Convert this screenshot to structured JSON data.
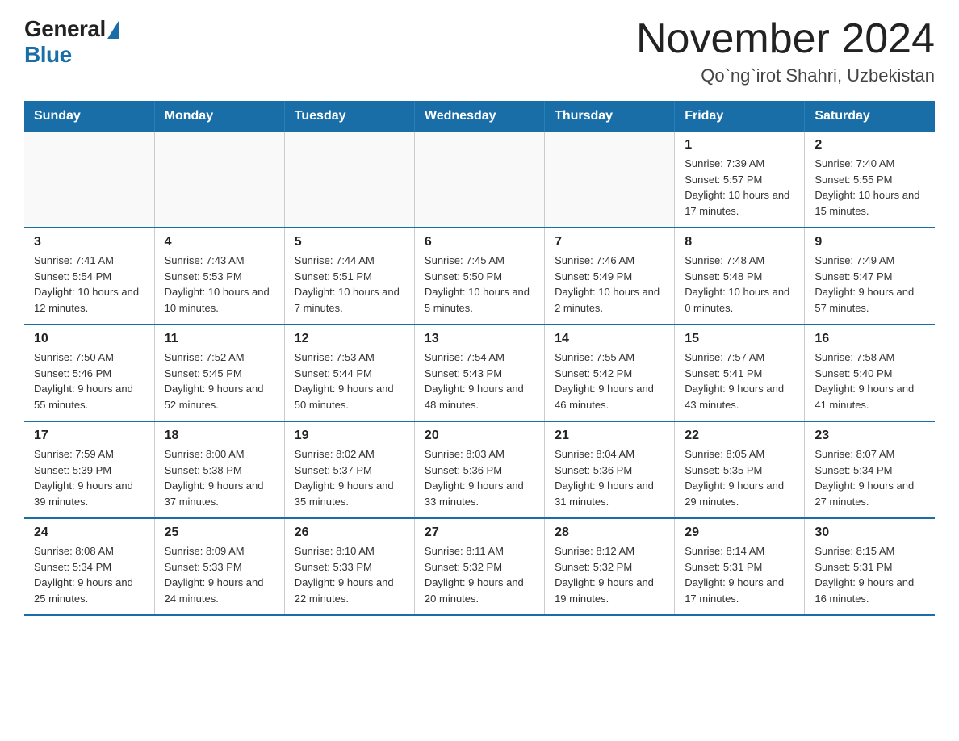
{
  "logo": {
    "general": "General",
    "blue": "Blue"
  },
  "title": "November 2024",
  "location": "Qo`ng`irot Shahri, Uzbekistan",
  "days_of_week": [
    "Sunday",
    "Monday",
    "Tuesday",
    "Wednesday",
    "Thursday",
    "Friday",
    "Saturday"
  ],
  "weeks": [
    [
      {
        "day": "",
        "info": ""
      },
      {
        "day": "",
        "info": ""
      },
      {
        "day": "",
        "info": ""
      },
      {
        "day": "",
        "info": ""
      },
      {
        "day": "",
        "info": ""
      },
      {
        "day": "1",
        "info": "Sunrise: 7:39 AM\nSunset: 5:57 PM\nDaylight: 10 hours and 17 minutes."
      },
      {
        "day": "2",
        "info": "Sunrise: 7:40 AM\nSunset: 5:55 PM\nDaylight: 10 hours and 15 minutes."
      }
    ],
    [
      {
        "day": "3",
        "info": "Sunrise: 7:41 AM\nSunset: 5:54 PM\nDaylight: 10 hours and 12 minutes."
      },
      {
        "day": "4",
        "info": "Sunrise: 7:43 AM\nSunset: 5:53 PM\nDaylight: 10 hours and 10 minutes."
      },
      {
        "day": "5",
        "info": "Sunrise: 7:44 AM\nSunset: 5:51 PM\nDaylight: 10 hours and 7 minutes."
      },
      {
        "day": "6",
        "info": "Sunrise: 7:45 AM\nSunset: 5:50 PM\nDaylight: 10 hours and 5 minutes."
      },
      {
        "day": "7",
        "info": "Sunrise: 7:46 AM\nSunset: 5:49 PM\nDaylight: 10 hours and 2 minutes."
      },
      {
        "day": "8",
        "info": "Sunrise: 7:48 AM\nSunset: 5:48 PM\nDaylight: 10 hours and 0 minutes."
      },
      {
        "day": "9",
        "info": "Sunrise: 7:49 AM\nSunset: 5:47 PM\nDaylight: 9 hours and 57 minutes."
      }
    ],
    [
      {
        "day": "10",
        "info": "Sunrise: 7:50 AM\nSunset: 5:46 PM\nDaylight: 9 hours and 55 minutes."
      },
      {
        "day": "11",
        "info": "Sunrise: 7:52 AM\nSunset: 5:45 PM\nDaylight: 9 hours and 52 minutes."
      },
      {
        "day": "12",
        "info": "Sunrise: 7:53 AM\nSunset: 5:44 PM\nDaylight: 9 hours and 50 minutes."
      },
      {
        "day": "13",
        "info": "Sunrise: 7:54 AM\nSunset: 5:43 PM\nDaylight: 9 hours and 48 minutes."
      },
      {
        "day": "14",
        "info": "Sunrise: 7:55 AM\nSunset: 5:42 PM\nDaylight: 9 hours and 46 minutes."
      },
      {
        "day": "15",
        "info": "Sunrise: 7:57 AM\nSunset: 5:41 PM\nDaylight: 9 hours and 43 minutes."
      },
      {
        "day": "16",
        "info": "Sunrise: 7:58 AM\nSunset: 5:40 PM\nDaylight: 9 hours and 41 minutes."
      }
    ],
    [
      {
        "day": "17",
        "info": "Sunrise: 7:59 AM\nSunset: 5:39 PM\nDaylight: 9 hours and 39 minutes."
      },
      {
        "day": "18",
        "info": "Sunrise: 8:00 AM\nSunset: 5:38 PM\nDaylight: 9 hours and 37 minutes."
      },
      {
        "day": "19",
        "info": "Sunrise: 8:02 AM\nSunset: 5:37 PM\nDaylight: 9 hours and 35 minutes."
      },
      {
        "day": "20",
        "info": "Sunrise: 8:03 AM\nSunset: 5:36 PM\nDaylight: 9 hours and 33 minutes."
      },
      {
        "day": "21",
        "info": "Sunrise: 8:04 AM\nSunset: 5:36 PM\nDaylight: 9 hours and 31 minutes."
      },
      {
        "day": "22",
        "info": "Sunrise: 8:05 AM\nSunset: 5:35 PM\nDaylight: 9 hours and 29 minutes."
      },
      {
        "day": "23",
        "info": "Sunrise: 8:07 AM\nSunset: 5:34 PM\nDaylight: 9 hours and 27 minutes."
      }
    ],
    [
      {
        "day": "24",
        "info": "Sunrise: 8:08 AM\nSunset: 5:34 PM\nDaylight: 9 hours and 25 minutes."
      },
      {
        "day": "25",
        "info": "Sunrise: 8:09 AM\nSunset: 5:33 PM\nDaylight: 9 hours and 24 minutes."
      },
      {
        "day": "26",
        "info": "Sunrise: 8:10 AM\nSunset: 5:33 PM\nDaylight: 9 hours and 22 minutes."
      },
      {
        "day": "27",
        "info": "Sunrise: 8:11 AM\nSunset: 5:32 PM\nDaylight: 9 hours and 20 minutes."
      },
      {
        "day": "28",
        "info": "Sunrise: 8:12 AM\nSunset: 5:32 PM\nDaylight: 9 hours and 19 minutes."
      },
      {
        "day": "29",
        "info": "Sunrise: 8:14 AM\nSunset: 5:31 PM\nDaylight: 9 hours and 17 minutes."
      },
      {
        "day": "30",
        "info": "Sunrise: 8:15 AM\nSunset: 5:31 PM\nDaylight: 9 hours and 16 minutes."
      }
    ]
  ]
}
